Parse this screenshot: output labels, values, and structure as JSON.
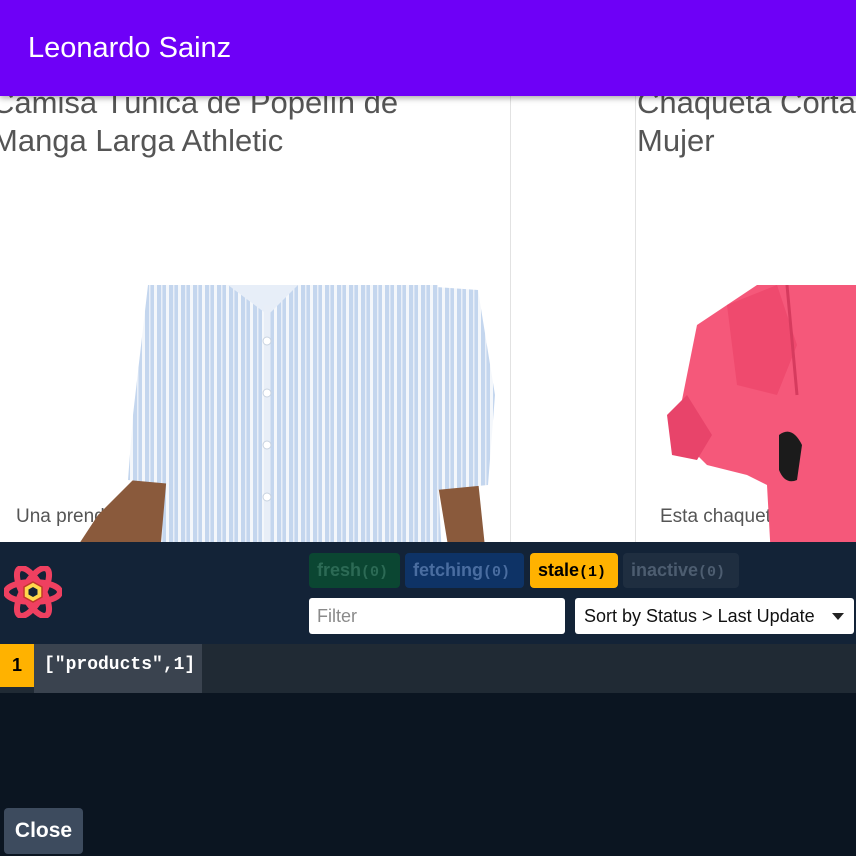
{
  "appbar": {
    "title": "Leonardo Sainz"
  },
  "products": [
    {
      "title_line1": "Camisa Túnica de Popelín de",
      "title_line2": "Manga Larga Athletic",
      "description": "Una prenda básica en el armario, esta camisa"
    },
    {
      "title_line1": "Chaqueta Corta",
      "title_line2": "Mujer",
      "description": "Esta chaqueta imper"
    }
  ],
  "devtools": {
    "status": {
      "fresh": {
        "label": "fresh",
        "count": "(0)"
      },
      "fetching": {
        "label": "fetching",
        "count": "(0)"
      },
      "stale": {
        "label": "stale",
        "count": "(1)"
      },
      "inactive": {
        "label": "inactive",
        "count": "(0)"
      }
    },
    "filter_placeholder": "Filter",
    "sort_label": "Sort by Status > Last Update",
    "queries": [
      {
        "observers": "1",
        "key": "[\"products\",1]"
      }
    ],
    "close_label": "Close"
  },
  "colors": {
    "appbar": "#6e00f7",
    "devtools_bg": "#0b1521",
    "stale": "#ffb200"
  }
}
